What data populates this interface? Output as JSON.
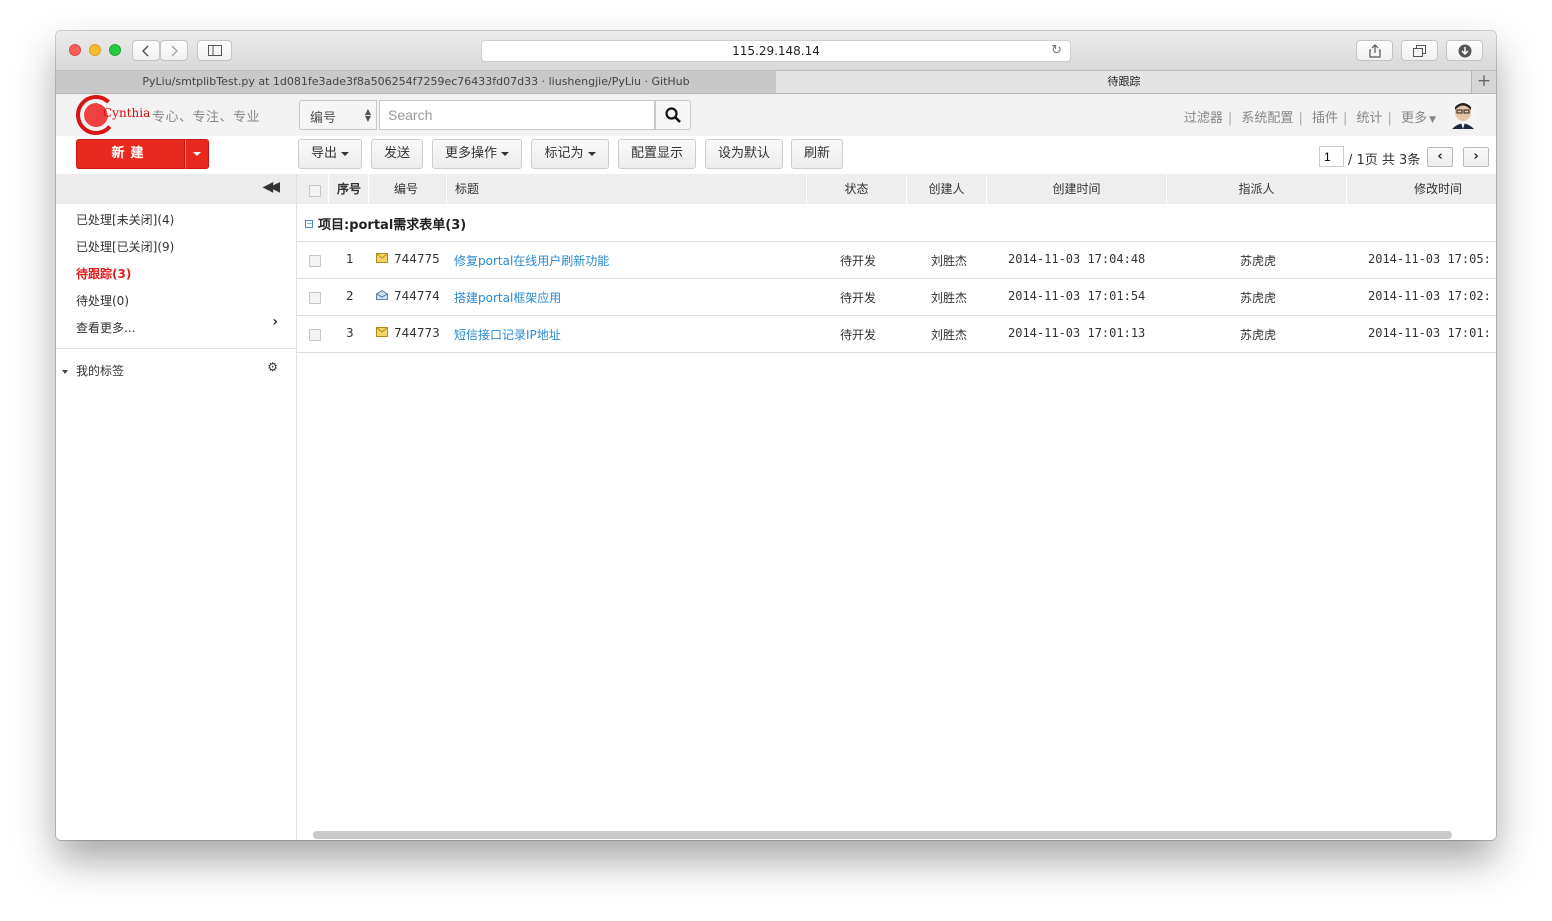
{
  "browser": {
    "url": "115.29.148.14",
    "tabs": [
      {
        "label": "PyLiu/smtplibTest.py at 1d081fe3ade3f8a506254f7259ec76433fd07d33 · liushengjie/PyLiu · GitHub"
      },
      {
        "label": "待跟踪"
      }
    ],
    "new_tab": "+"
  },
  "header": {
    "logo_text": "Cynthia",
    "slogan": "专心、专注、专业",
    "search_field_select": "编号",
    "search_placeholder": "Search",
    "links": [
      "过滤器",
      "系统配置",
      "插件",
      "统计",
      "更多"
    ]
  },
  "toolbar": {
    "new_label": "新建",
    "export": "导出",
    "send": "发送",
    "more_ops": "更多操作",
    "mark_as": "标记为",
    "config_display": "配置显示",
    "set_default": "设为默认",
    "refresh": "刷新",
    "page_value": "1",
    "page_summary": "/ 1页 共 3条"
  },
  "sidebar": {
    "items": [
      {
        "label": "已处理[未关闭](4)"
      },
      {
        "label": "已处理[已关闭](9)"
      },
      {
        "label": "待跟踪(3)"
      },
      {
        "label": "待处理(0)"
      },
      {
        "label": "查看更多..."
      }
    ],
    "tags_label": "我的标签"
  },
  "grid": {
    "columns": [
      "序号",
      "编号",
      "标题",
      "状态",
      "创建人",
      "创建时间",
      "指派人",
      "修改时间"
    ],
    "group_label": "项目:portal需求表单(3)",
    "rows": [
      {
        "seq": "1",
        "id": "744775",
        "title": "修复portal在线用户刷新功能",
        "status": "待开发",
        "creator": "刘胜杰",
        "created": "2014-11-03 17:04:48",
        "assignee": "苏虎虎",
        "modified": "2014-11-03 17:05:"
      },
      {
        "seq": "2",
        "id": "744774",
        "title": "搭建portal框架应用",
        "status": "待开发",
        "creator": "刘胜杰",
        "created": "2014-11-03 17:01:54",
        "assignee": "苏虎虎",
        "modified": "2014-11-03 17:02:"
      },
      {
        "seq": "3",
        "id": "744773",
        "title": "短信接口记录IP地址",
        "status": "待开发",
        "creator": "刘胜杰",
        "created": "2014-11-03 17:01:13",
        "assignee": "苏虎虎",
        "modified": "2014-11-03 17:01:"
      }
    ]
  }
}
